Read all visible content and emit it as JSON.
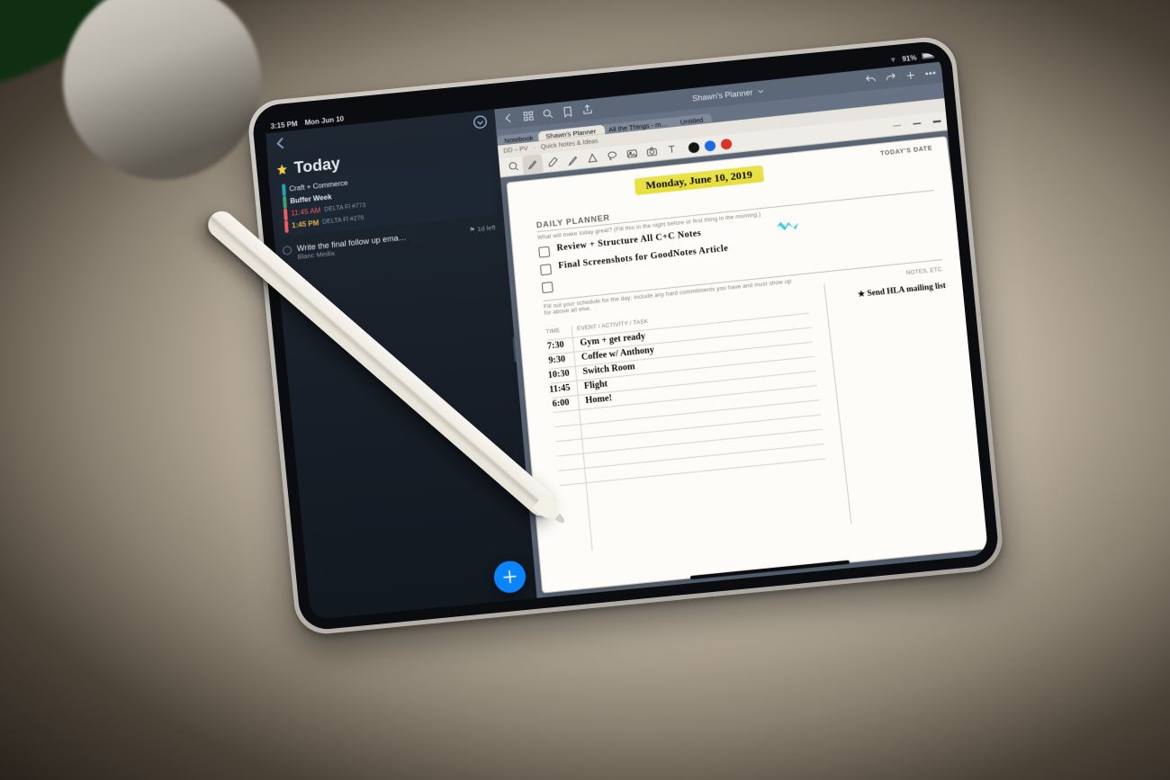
{
  "statusbar": {
    "time": "3:15 PM",
    "date": "Mon Jun 10",
    "battery": "91%"
  },
  "things": {
    "title": "Today",
    "agenda": {
      "l1": "Craft + Commerce",
      "l2": "Buffer Week",
      "l3_time": "11:45 AM",
      "l3_rest": "DELTA Fl #773",
      "l4_time": "1:45 PM",
      "l4_rest": "DELTA Fl #276"
    },
    "task": {
      "title": "Write the final follow up ema…",
      "project": "Blanc Media",
      "flag": "⚑ 1d left"
    },
    "add_label": "+"
  },
  "goodnotes": {
    "top_title": "Shawn's Planner",
    "tabs": [
      "Notebook",
      "Shawn's Planner",
      "All the Things - m…",
      "Untitled"
    ],
    "crumb_left": "DD – PV",
    "crumb_right": "Quick Notes & Ideas",
    "toolbar": {
      "pressure_1": "—",
      "pressure_2": "—",
      "pressure_3": "—"
    },
    "page": {
      "date_hand": "Monday, June 10, 2019",
      "header": "DAILY PLANNER",
      "header_date": "TODAY'S DATE",
      "q1": "What will make today great?  (Fill this in the night before or first thing in the morning.)",
      "todo1": "Review + Structure   All   C+C  Notes",
      "todo2": "Final  Screenshots   for   GoodNotes  Article",
      "q2": "Fill out your schedule for the day; include any hard commitments you have and must show up for above all else.",
      "col_time": "TIME",
      "col_event": "EVENT / ACTIVITY / TASK",
      "notes_head": "NOTES, ETC.",
      "sched": [
        {
          "t": "7:30",
          "e": "Gym + get ready"
        },
        {
          "t": "9:30",
          "e": "Coffee w/ Anthony"
        },
        {
          "t": "10:30",
          "e": "Switch Room"
        },
        {
          "t": "11:45",
          "e": "Flight"
        },
        {
          "t": "6:00",
          "e": "Home!"
        }
      ],
      "note1": "★ Send  HLA  mailing  list"
    }
  }
}
